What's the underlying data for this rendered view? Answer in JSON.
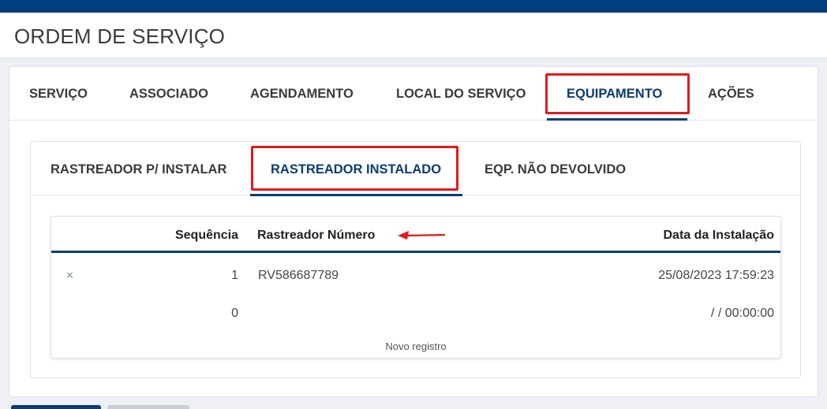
{
  "page": {
    "title": "ORDEM DE SERVIÇO"
  },
  "main_tabs": [
    {
      "label": "SERVIÇO"
    },
    {
      "label": "ASSOCIADO"
    },
    {
      "label": "AGENDAMENTO"
    },
    {
      "label": "LOCAL DO SERVIÇO"
    },
    {
      "label": "EQUIPAMENTO",
      "active": true
    },
    {
      "label": "AÇÕES"
    }
  ],
  "sub_tabs": [
    {
      "label": "RASTREADOR P/ INSTALAR"
    },
    {
      "label": "RASTREADOR INSTALADO",
      "active": true
    },
    {
      "label": "EQP. NÃO DEVOLVIDO"
    }
  ],
  "grid": {
    "columns": [
      "Sequência",
      "Rastreador Número",
      "Data da Instalação"
    ],
    "rows": [
      {
        "seq": "1",
        "number": "RV586687789",
        "date": "25/08/2023 17:59:23",
        "delete_icon": "×"
      },
      {
        "seq": "0",
        "number": "",
        "date": " / / 00:00:00"
      }
    ],
    "new_record_label": "Novo registro"
  },
  "colors": {
    "brand": "#003f7f",
    "active_tab": "#0b3c73",
    "highlight": "#e21a1a"
  }
}
